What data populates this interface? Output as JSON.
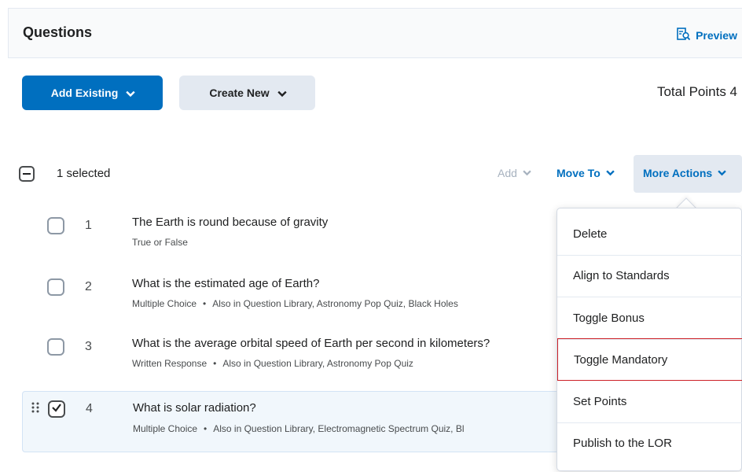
{
  "header": {
    "title": "Questions",
    "preview_label": "Preview"
  },
  "toolbar": {
    "add_existing_label": "Add Existing",
    "create_new_label": "Create New",
    "total_points_label": "Total Points 4"
  },
  "selection_bar": {
    "selected_label": "1 selected",
    "add_label": "Add",
    "move_to_label": "Move To",
    "more_actions_label": "More Actions"
  },
  "questions": [
    {
      "number": "1",
      "title": "The Earth is round because of gravity",
      "type": "True or False",
      "also_in": "",
      "selected": false
    },
    {
      "number": "2",
      "title": "What is the estimated age of Earth?",
      "type": "Multiple Choice",
      "also_in": "Also in Question Library, Astronomy Pop Quiz, Black Holes",
      "selected": false
    },
    {
      "number": "3",
      "title": "What is the average orbital speed of Earth per second in kilometers?",
      "type": "Written Response",
      "also_in": "Also in Question Library, Astronomy Pop Quiz",
      "selected": false
    },
    {
      "number": "4",
      "title": "What is solar radiation?",
      "type": "Multiple Choice",
      "also_in": "Also in Question Library, Electromagnetic Spectrum Quiz, Bl",
      "selected": true
    }
  ],
  "more_actions_menu": {
    "items": [
      {
        "label": "Delete"
      },
      {
        "label": "Align to Standards"
      },
      {
        "label": "Toggle Bonus"
      },
      {
        "label": "Toggle Mandatory"
      },
      {
        "label": "Set Points"
      },
      {
        "label": "Publish to the LOR"
      }
    ],
    "highlighted_item": "Toggle Mandatory"
  },
  "colors": {
    "primary": "#006fbf",
    "secondary_button": "#e3e9f1",
    "highlight_border": "#cd2026",
    "selected_row": "#f1f7fc"
  },
  "icons": {
    "preview": "preview-magnifier-icon",
    "dropdown": "chevron-down-icon",
    "checkbox_checked": "checkmark-icon",
    "drag": "drag-handle-icon"
  }
}
